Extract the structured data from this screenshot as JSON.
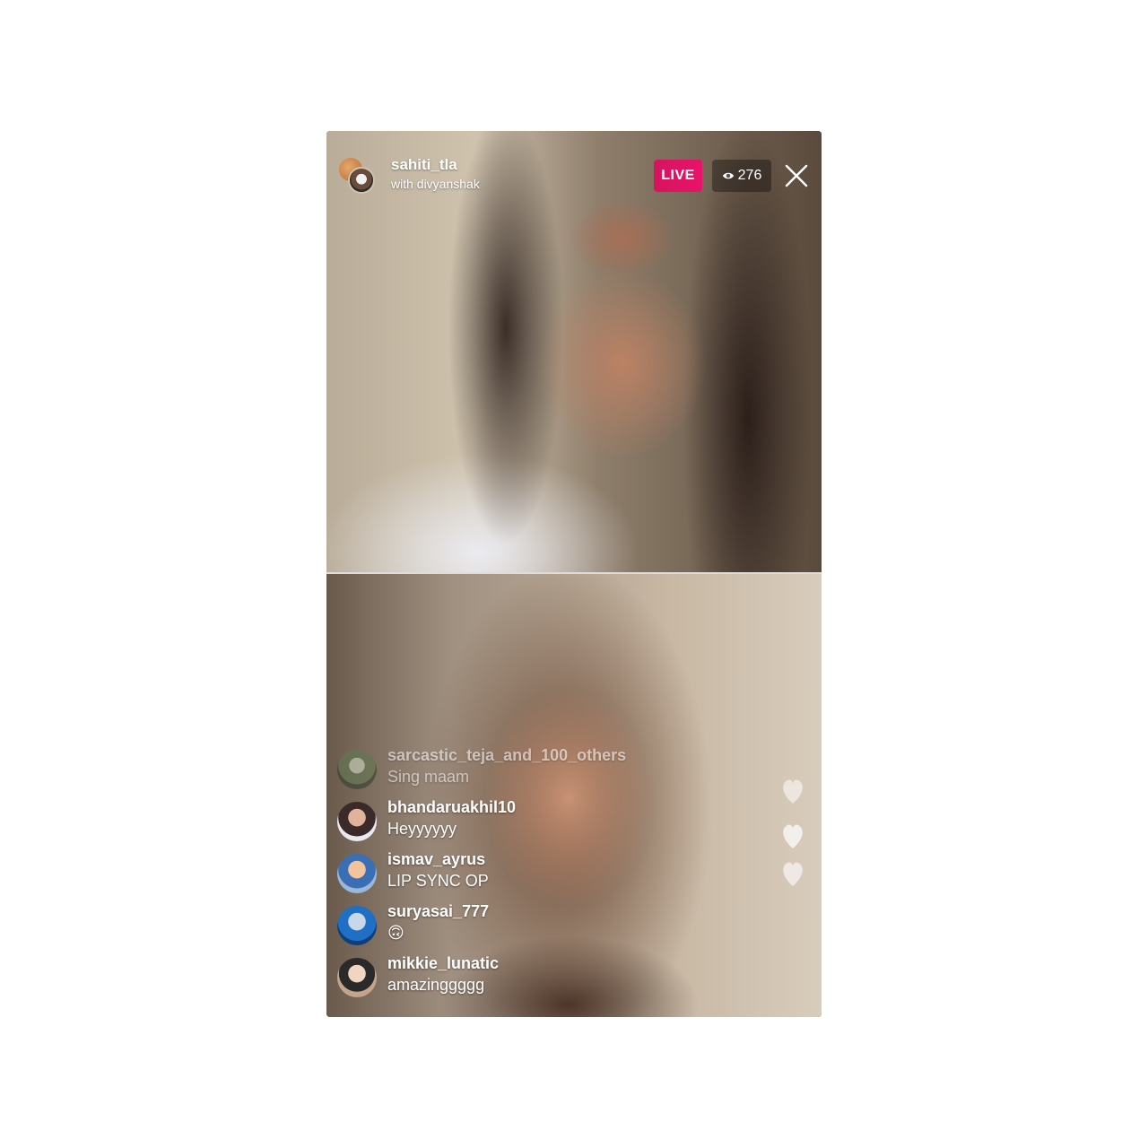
{
  "live": {
    "host_username": "sahiti_tla",
    "guest_line": "with divyanshak",
    "live_label": "LIVE",
    "viewer_count": "276"
  },
  "comments": [
    {
      "username": "sarcastic_teja_and_100_others",
      "message": "Sing maam"
    },
    {
      "username": "bhandaruakhil10",
      "message": "Heyyyyyy"
    },
    {
      "username": "ismav_ayrus",
      "message": "LIP SYNC OP"
    },
    {
      "username": "suryasai_777",
      "message": "🙃"
    },
    {
      "username": "mikkie_lunatic",
      "message": "amazinggggg"
    }
  ],
  "colors": {
    "live_badge": "#e1306c",
    "text": "#ffffff"
  },
  "icons": [
    "eye-icon",
    "close-icon",
    "heart-icon"
  ]
}
